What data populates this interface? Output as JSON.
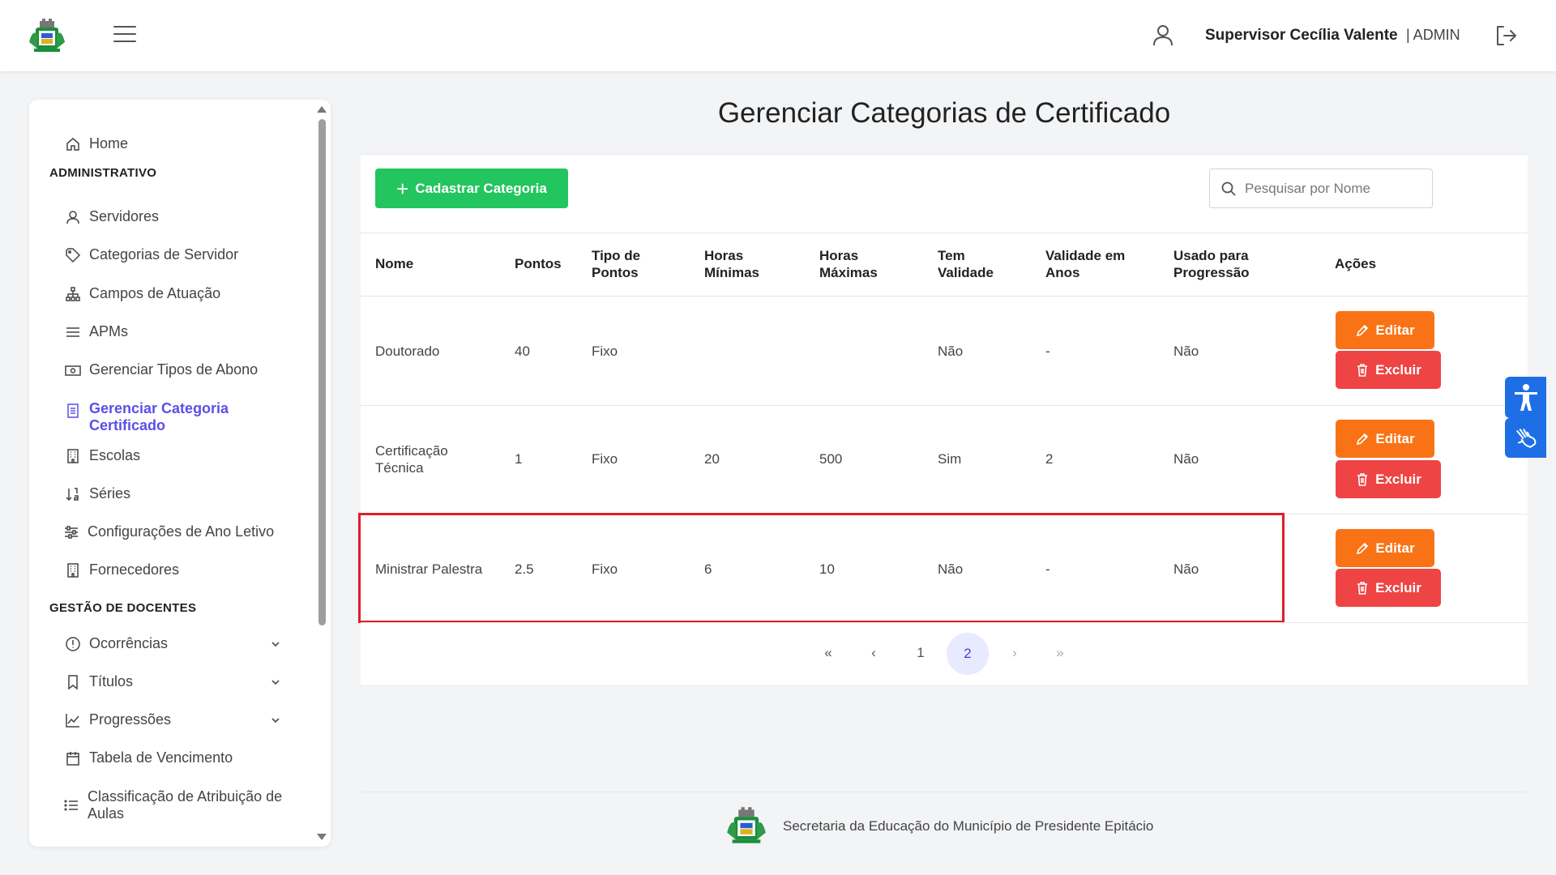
{
  "header": {
    "user_name": "Supervisor Cecília Valente",
    "user_role": "| ADMIN"
  },
  "sidebar": {
    "home": "Home",
    "section_admin": "ADMINISTRATIVO",
    "servidores": "Servidores",
    "categorias_servidor": "Categorias de Servidor",
    "campos_atuacao": "Campos de Atuação",
    "apms": "APMs",
    "tipos_abono": "Gerenciar Tipos de Abono",
    "categoria_certificado_line1": "Gerenciar Categoria",
    "categoria_certificado_line2": "Certificado",
    "escolas": "Escolas",
    "series": "Séries",
    "config_ano": "Configurações de Ano Letivo",
    "fornecedores": "Fornecedores",
    "section_docentes": "GESTÃO DE DOCENTES",
    "ocorrencias": "Ocorrências",
    "titulos": "Títulos",
    "progressoes": "Progressões",
    "tabela_vencimento": "Tabela de Vencimento",
    "classificacao_line1": "Classificação de Atribuição de",
    "classificacao_line2": "Aulas"
  },
  "main": {
    "title": "Gerenciar Categorias de Certificado",
    "add_button": "Cadastrar Categoria",
    "search_placeholder": "Pesquisar por Nome"
  },
  "table": {
    "headers": {
      "nome": "Nome",
      "pontos": "Pontos",
      "tipo_l1": "Tipo de",
      "tipo_l2": "Pontos",
      "hmin_l1": "Horas",
      "hmin_l2": "Mínimas",
      "hmax_l1": "Horas",
      "hmax_l2": "Máximas",
      "tem_l1": "Tem",
      "tem_l2": "Validade",
      "val_l1": "Validade em",
      "val_l2": "Anos",
      "usado_l1": "Usado para",
      "usado_l2": "Progressão",
      "acoes": "Ações"
    },
    "rows": [
      {
        "nome_l1": "Doutorado",
        "nome_l2": "",
        "pontos": "40",
        "tipo": "Fixo",
        "hmin": "",
        "hmax": "",
        "tem": "Não",
        "validade": "-",
        "usado": "Não"
      },
      {
        "nome_l1": "Certificação",
        "nome_l2": "Técnica",
        "pontos": "1",
        "tipo": "Fixo",
        "hmin": "20",
        "hmax": "500",
        "tem": "Sim",
        "validade": "2",
        "usado": "Não"
      },
      {
        "nome_l1": "Ministrar Palestra",
        "nome_l2": "",
        "pontos": "2.5",
        "tipo": "Fixo",
        "hmin": "6",
        "hmax": "10",
        "tem": "Não",
        "validade": "-",
        "usado": "Não"
      }
    ],
    "edit_label": "Editar",
    "delete_label": "Excluir"
  },
  "pagination": {
    "first": "«",
    "prev": "‹",
    "page1": "1",
    "page2": "2",
    "next": "›",
    "last": "»"
  },
  "footer": {
    "text": "Secretaria da Educação do Município de Presidente Epitácio"
  },
  "colors": {
    "accent": "#5b4fe8",
    "add": "#22c55e",
    "edit": "#f97316",
    "delete": "#ef4444",
    "highlight": "#e11d2a",
    "accessibility": "#1e6fe6"
  }
}
